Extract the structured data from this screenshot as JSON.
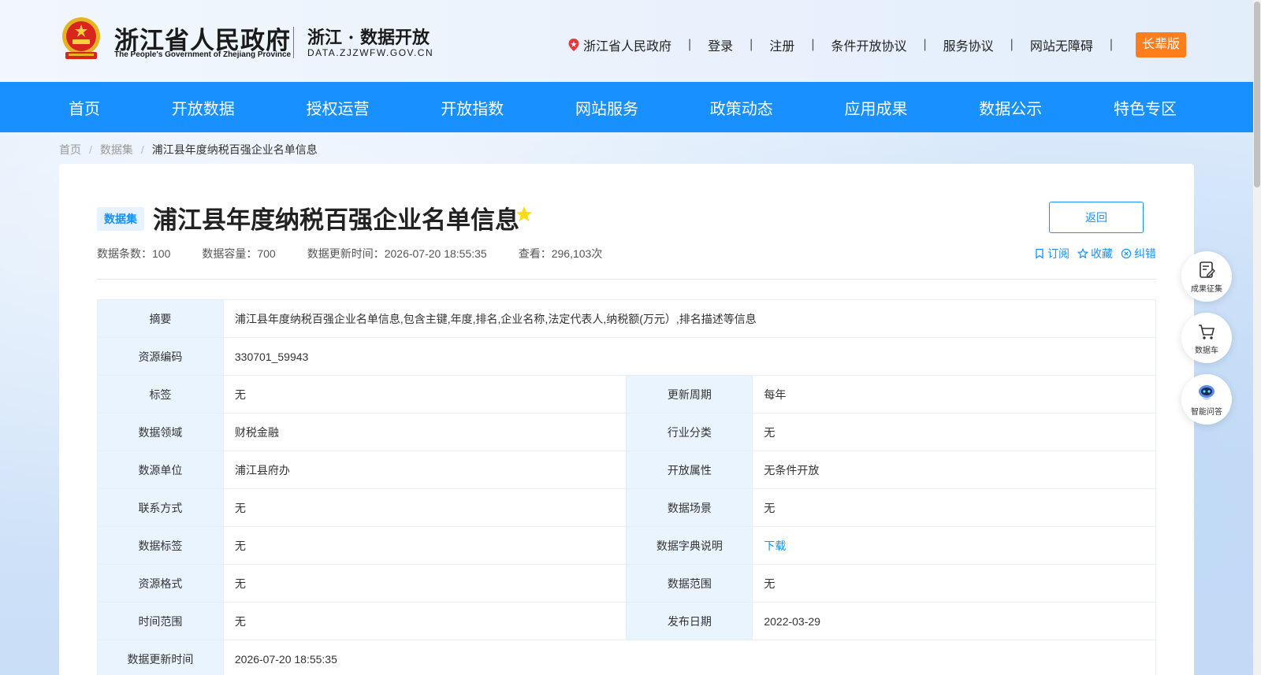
{
  "header": {
    "logo_cn": "浙江省人民政府",
    "logo_en": "The People's Government of Zhejiang Province",
    "subtitle": "浙江 · 数据开放",
    "domain": "DATA.ZJZWFW.GOV.CN",
    "links": {
      "gov": "浙江省人民政府",
      "login": "登录",
      "register": "注册",
      "conditional": "条件开放协议",
      "service": "服务协议",
      "accessible": "网站无障碍",
      "sep": "|"
    },
    "elder_mode": "长辈版"
  },
  "nav": {
    "home": "首页",
    "open_data": "开放数据",
    "authorized": "授权运营",
    "index": "开放指数",
    "services": "网站服务",
    "policy": "政策动态",
    "apps": "应用成果",
    "public": "数据公示",
    "special": "特色专区"
  },
  "breadcrumb": {
    "home": "首页",
    "datasets": "数据集",
    "current": "浦江县年度纳税百强企业名单信息",
    "sep": "/"
  },
  "dataset": {
    "badge": "数据集",
    "title": "浦江县年度纳税百强企业名单信息",
    "back": "返回",
    "meta": {
      "count": "数据条数：100",
      "capacity": "数据容量：700",
      "updated": "数据更新时间：2026-07-20 18:55:35",
      "views": "查看：296,103次"
    },
    "actions": {
      "subscribe": "订阅",
      "favorite": "收藏",
      "report": "纠错"
    }
  },
  "table": {
    "summary_k": "摘要",
    "summary_v": "浦江县年度纳税百强企业名单信息,包含主键,年度,排名,企业名称,法定代表人,纳税额(万元）,排名描述等信息",
    "code_k": "资源编码",
    "code_v": "330701_59943",
    "tag_k": "标签",
    "tag_v": "无",
    "cycle_k": "更新周期",
    "cycle_v": "每年",
    "domain_k": "数据领域",
    "domain_v": "财税金融",
    "industry_k": "行业分类",
    "industry_v": "无",
    "source_k": "数源单位",
    "source_v": "浦江县府办",
    "open_k": "开放属性",
    "open_v": "无条件开放",
    "contact_k": "联系方式",
    "contact_v": "无",
    "scene_k": "数据场景",
    "scene_v": "无",
    "dtag_k": "数据标签",
    "dtag_v": "无",
    "dict_k": "数据字典说明",
    "dict_v": "下载",
    "format_k": "资源格式",
    "format_v": "无",
    "range_k": "数据范围",
    "range_v": "无",
    "time_k": "时间范围",
    "time_v": "无",
    "pub_k": "发布日期",
    "pub_v": "2022-03-29",
    "upd_k": "数据更新时间",
    "upd_v": "2026-07-20 18:55:35"
  },
  "side": {
    "results": "成果征集",
    "cart": "数据车",
    "qa": "智能问答"
  },
  "colors": {
    "primary": "#1890ff",
    "elder": "#ff7d1a",
    "star": "#fadb14",
    "key_bg": "#eaf4ff"
  },
  "icons": [
    "emblem-icon",
    "location-pin-icon",
    "star-icon",
    "bookmark-icon",
    "star-outline-icon",
    "error-circle-icon",
    "edit-icon",
    "cart-icon",
    "robot-icon"
  ]
}
